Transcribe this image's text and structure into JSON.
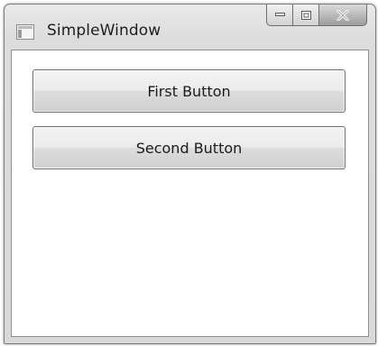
{
  "window": {
    "title": "SimpleWindow",
    "app_icon": "window-app-icon",
    "caption_buttons": {
      "minimize_icon": "minimize-icon",
      "maximize_icon": "maximize-icon",
      "close_icon": "close-icon"
    }
  },
  "buttons": {
    "first_label": "First Button",
    "second_label": "Second Button"
  },
  "colors": {
    "frame": "#d9d9d9",
    "client_background": "#ffffff",
    "button_border": "#707070",
    "close_button": "#9c9c9c"
  }
}
